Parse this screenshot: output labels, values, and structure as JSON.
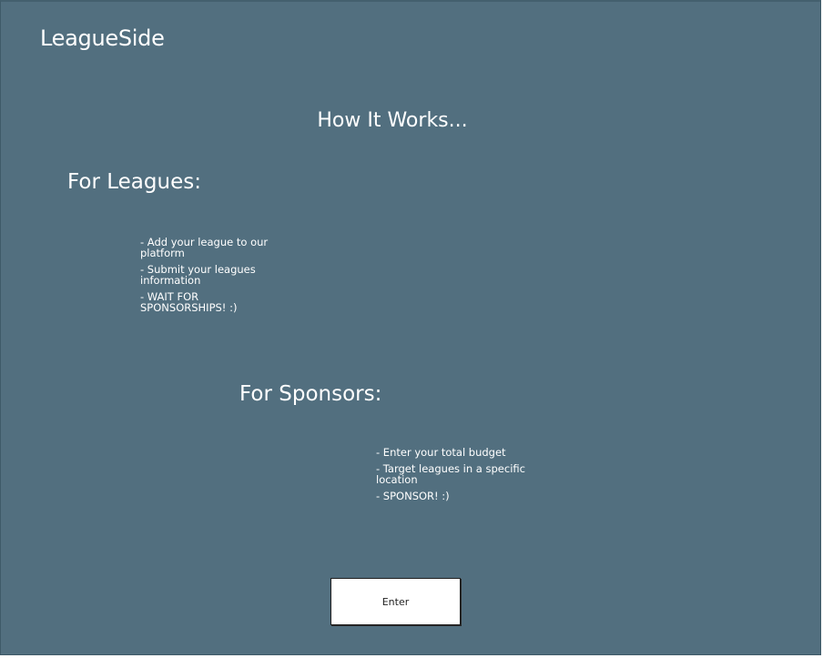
{
  "header": {
    "logo": "LeagueSide"
  },
  "main": {
    "title": "How It Works...",
    "leagues": {
      "heading": "For Leagues:",
      "items": [
        "- Add your league to our platform",
        "- Submit your leagues information",
        "- WAIT FOR SPONSORSHIPS! :)"
      ]
    },
    "sponsors": {
      "heading": "For Sponsors:",
      "items": [
        "- Enter your total budget",
        "- Target leagues in a specific location",
        "- SPONSOR! :)"
      ]
    },
    "enter_label": "Enter"
  },
  "colors": {
    "background": "#526f7f",
    "text": "#ffffff",
    "button_background": "#ffffff",
    "button_border": "#1e1e1e"
  }
}
